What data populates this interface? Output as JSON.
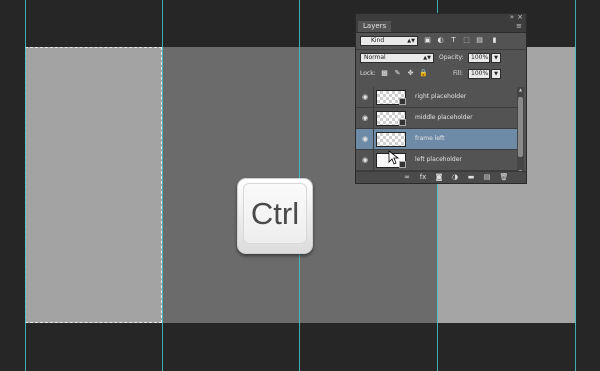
{
  "colors": {
    "pasteboard": "#262626",
    "document": "#6b6b6b",
    "frame_fill": "#a3a3a3",
    "guide": "#3fc6c9",
    "panel_bg": "#535353",
    "selected_layer": "#6d8aa7"
  },
  "key_overlay": {
    "label": "Ctrl"
  },
  "layers_panel": {
    "tab_label": "Layers",
    "collapse_glyph": "»",
    "close_glyph": "×",
    "menu_glyph": "≡",
    "filter": {
      "value": "Kind",
      "icon_glyphs": [
        "▣",
        "◐",
        "T",
        "⬚",
        "▤",
        "▮"
      ]
    },
    "blend_mode": "Normal",
    "opacity_label": "Opacity:",
    "opacity_value": "100%",
    "lock_label": "Lock:",
    "lock_icon_glyphs": [
      "▩",
      "✎",
      "✥",
      "🔒"
    ],
    "fill_label": "Fill:",
    "fill_value": "100%",
    "layers": [
      {
        "name": "right placeholder",
        "selected": false,
        "thumb": "transparent"
      },
      {
        "name": "middle placeholder",
        "selected": false,
        "thumb": "transparent"
      },
      {
        "name": "frame left",
        "selected": true,
        "thumb": "transparent"
      },
      {
        "name": "left placeholder",
        "selected": false,
        "thumb": "white"
      }
    ],
    "bottom_icons": [
      "∞",
      "fx",
      "◙",
      "◑",
      "▬",
      "▤",
      "🗑"
    ]
  }
}
